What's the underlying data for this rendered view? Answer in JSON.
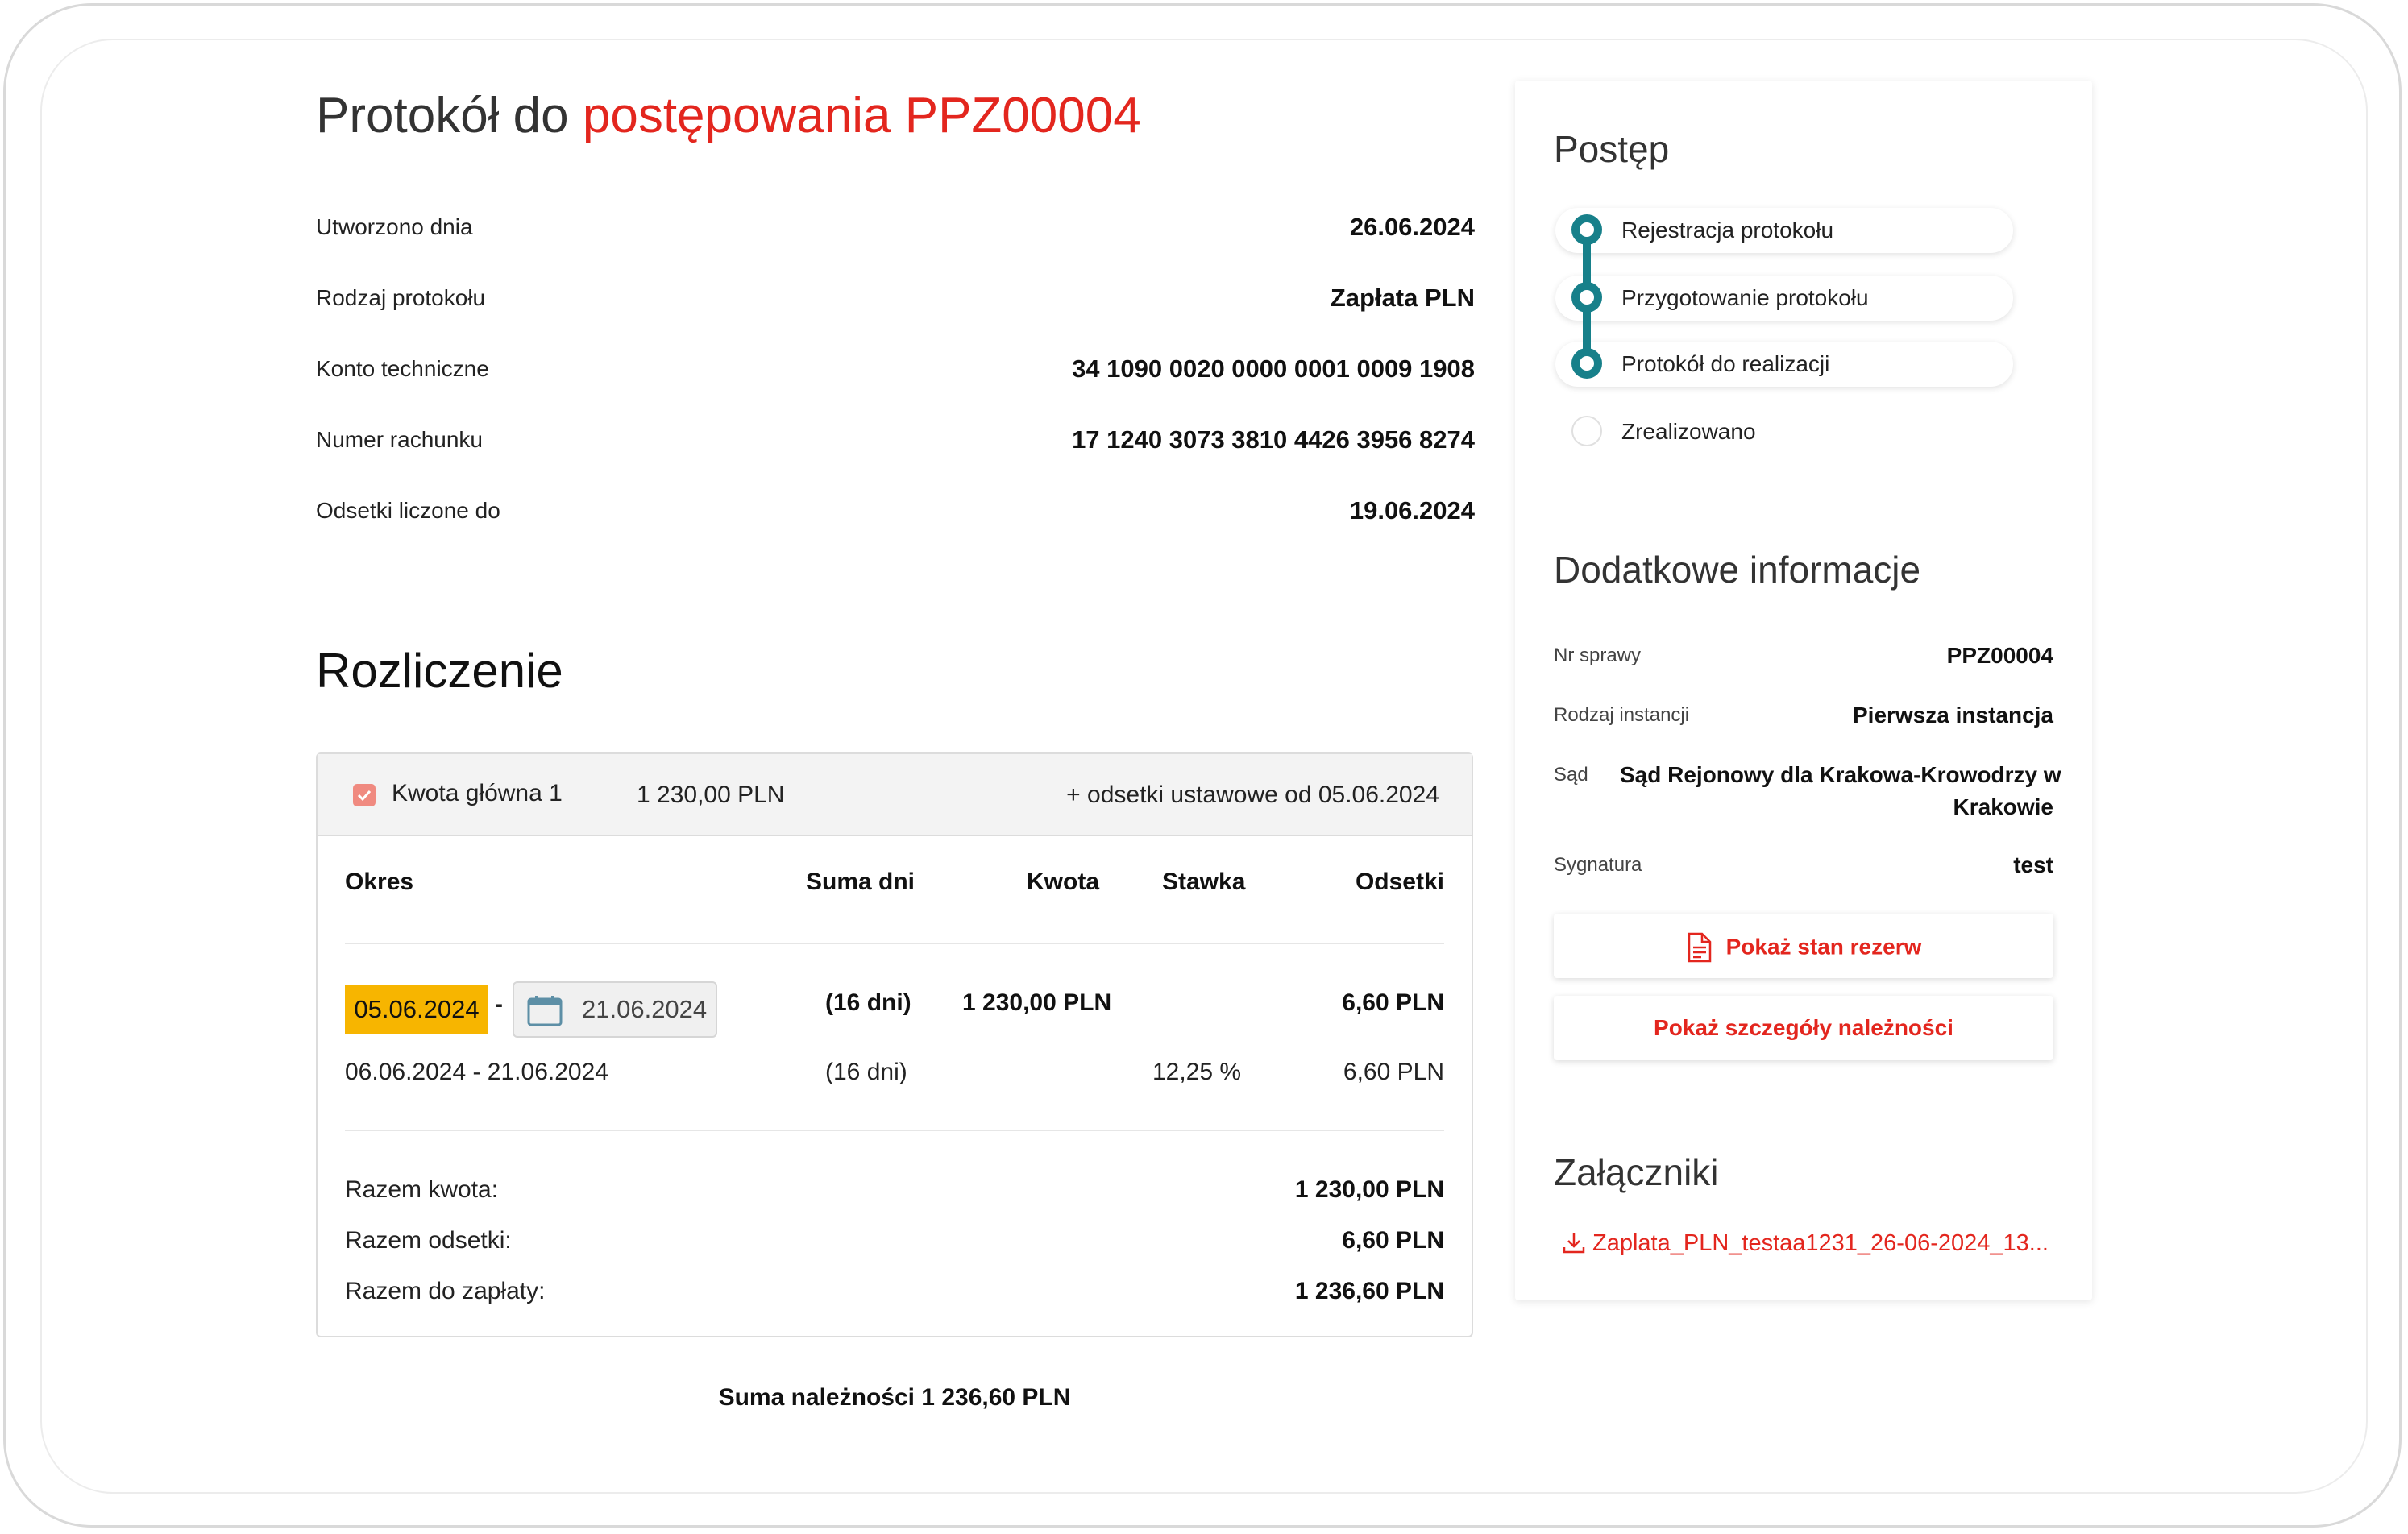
{
  "header": {
    "title_prefix": "Protokół do ",
    "title_highlight": "postępowania PPZ00004"
  },
  "details": [
    {
      "label": "Utworzono dnia",
      "value": "26.06.2024"
    },
    {
      "label": "Rodzaj protokołu",
      "value": "Zapłata PLN"
    },
    {
      "label": "Konto techniczne",
      "value": "34 1090 0020 0000 0001 0009 1908"
    },
    {
      "label": "Numer rachunku",
      "value": "17 1240 3073 3810 4426 3956 8274"
    },
    {
      "label": "Odsetki liczone do",
      "value": "19.06.2024"
    }
  ],
  "settlement": {
    "title": "Rozliczenie",
    "card": {
      "principal_label": "Kwota główna 1",
      "principal_amount": "1 230,00 PLN",
      "interest_note": "+ odsetki ustawowe od 05.06.2024",
      "columns": {
        "period": "Okres",
        "days": "Suma dni",
        "amount": "Kwota",
        "rate": "Stawka",
        "interest": "Odsetki"
      },
      "row_main": {
        "date_from": "05.06.2024",
        "dash": "-",
        "date_to": "21.06.2024",
        "days": "(16 dni)",
        "amount": "1 230,00 PLN",
        "interest": "6,60 PLN"
      },
      "row_sub": {
        "period": "06.06.2024 - 21.06.2024",
        "days": "(16 dni)",
        "rate": "12,25 %",
        "interest": "6,60 PLN"
      },
      "totals": [
        {
          "label": "Razem kwota:",
          "value": "1 230,00 PLN"
        },
        {
          "label": "Razem odsetki:",
          "value": "6,60 PLN"
        },
        {
          "label": "Razem do zapłaty:",
          "value": "1 236,60 PLN"
        }
      ]
    },
    "sum_text": "Suma należności 1 236,60 PLN"
  },
  "sidebar": {
    "progress_title": "Postęp",
    "steps": [
      {
        "label": "Rejestracja protokołu",
        "done": true
      },
      {
        "label": "Przygotowanie protokołu",
        "done": true
      },
      {
        "label": "Protokół do realizacji",
        "done": true
      },
      {
        "label": "Zrealizowano",
        "done": false
      }
    ],
    "info_title": "Dodatkowe informacje",
    "info": {
      "case_label": "Nr sprawy",
      "case_value": "PPZ00004",
      "instance_label": "Rodzaj instancji",
      "instance_value": "Pierwsza instancja",
      "court_label": "Sąd",
      "court_line1": "Sąd Rejonowy dla Krakowa-Krowodrzy w",
      "court_line2": "Krakowie",
      "signature_label": "Sygnatura",
      "signature_value": "test"
    },
    "btn_reserve": "Pokaż stan rezerw",
    "btn_details": "Pokaż szczegóły należności",
    "attachments_title": "Załączniki",
    "attachment_file": "Zaplata_PLN_testaa1231_26-06-2024_13..."
  },
  "colors": {
    "accent": "#e3261e",
    "teal": "#17808a",
    "highlight": "#f7b500"
  }
}
